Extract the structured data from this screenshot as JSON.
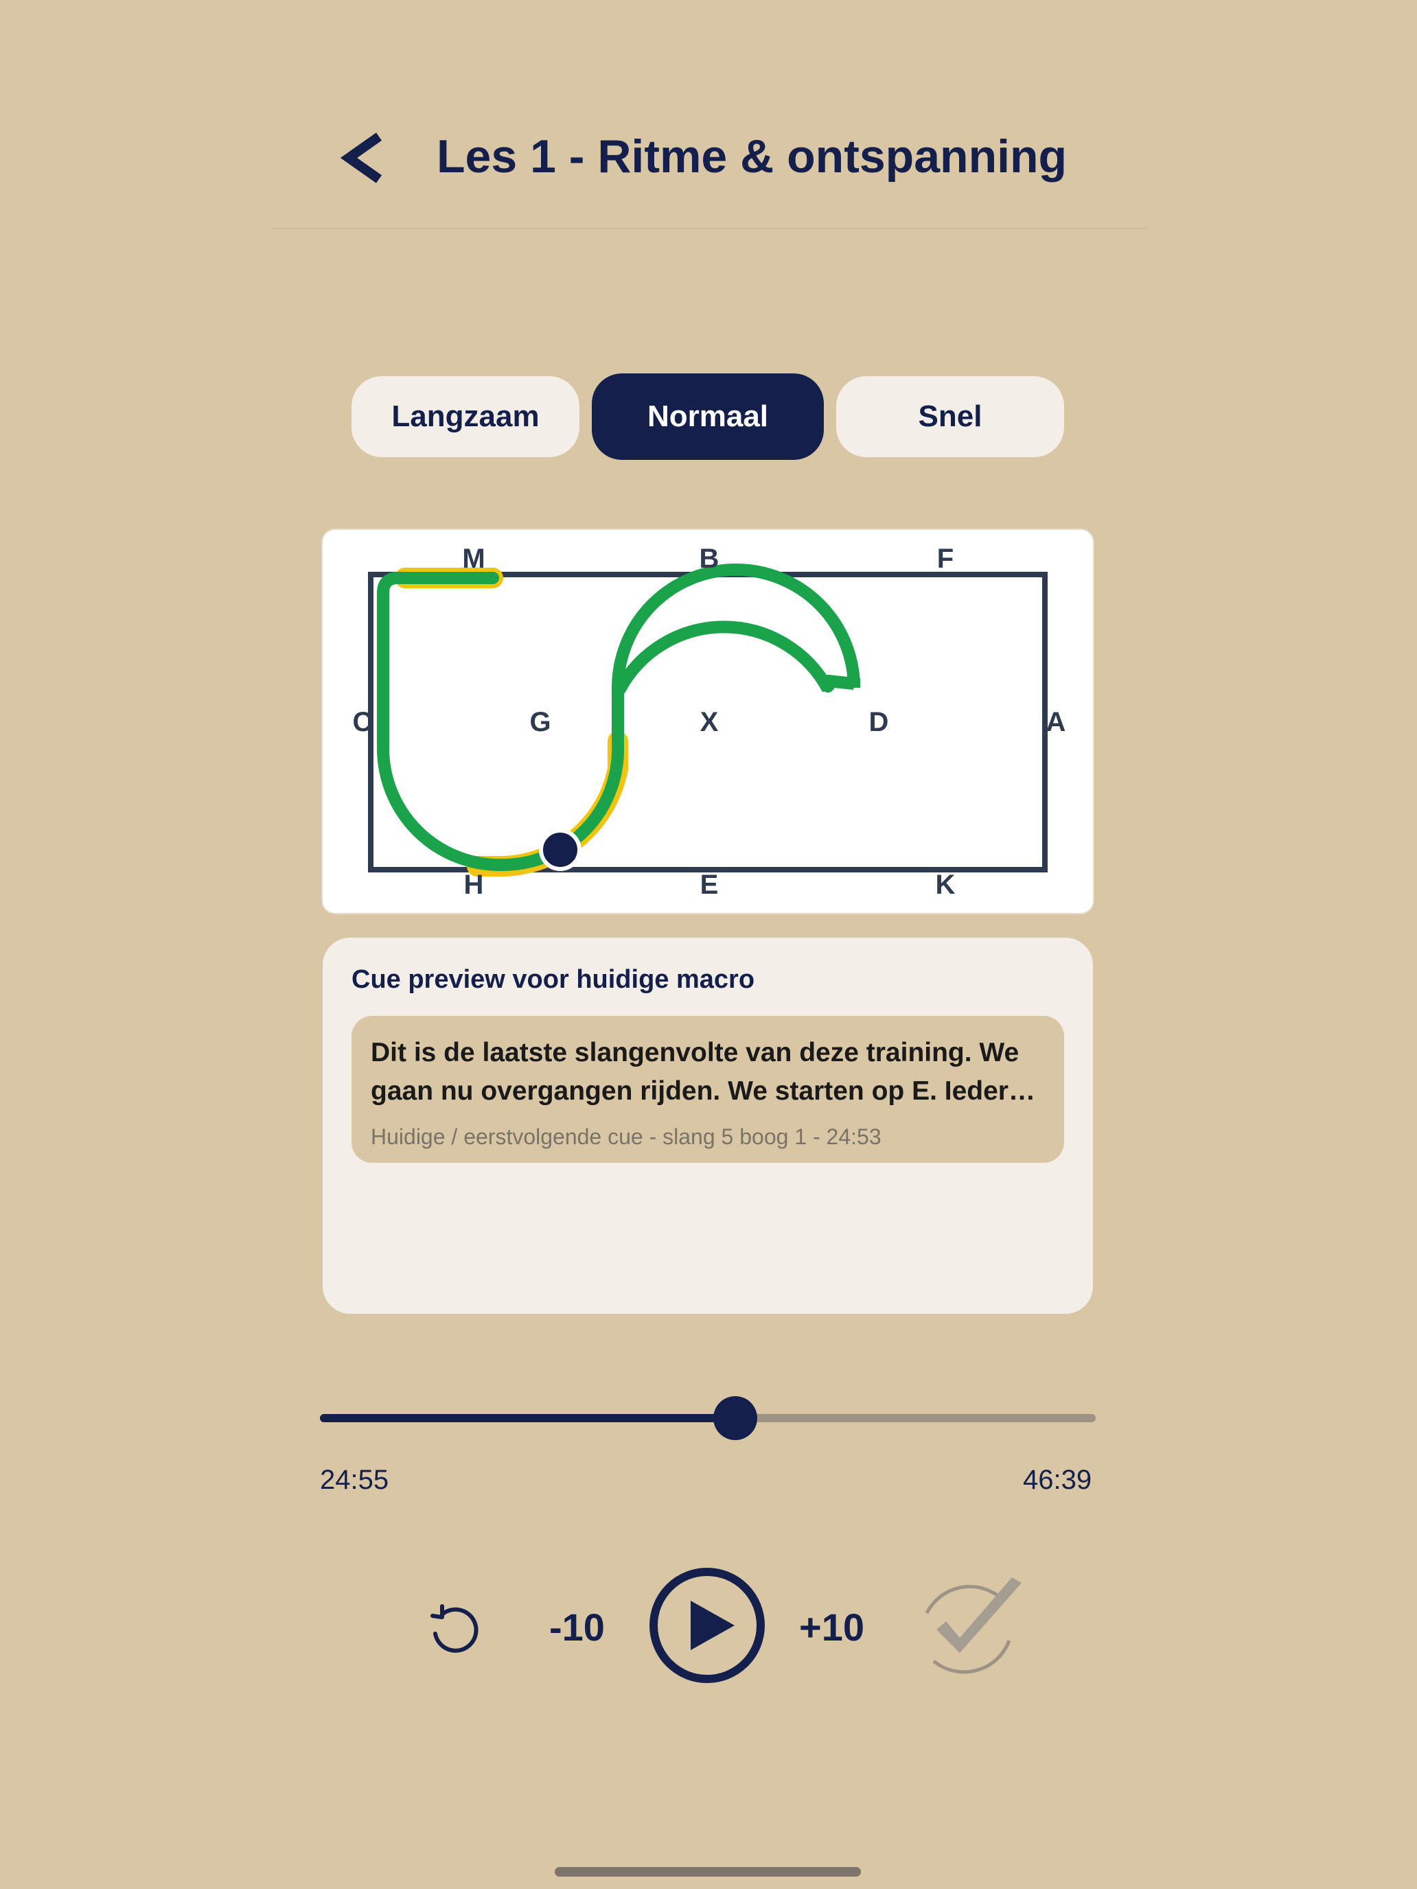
{
  "header": {
    "title": "Les 1 - Ritme & ontspanning",
    "back_icon": "chevron-left-icon"
  },
  "speed": {
    "options": [
      "Langzaam",
      "Normaal",
      "Snel"
    ],
    "selected": "Normaal"
  },
  "arena": {
    "letters": {
      "top": [
        "M",
        "B",
        "F"
      ],
      "middle": [
        "C",
        "G",
        "X",
        "D",
        "A"
      ],
      "bottom": [
        "H",
        "E",
        "K"
      ]
    },
    "colors": {
      "route": "#1aa34a",
      "highlight": "#f1c40f",
      "rider": "#14204b",
      "border": "#2e3a4f"
    }
  },
  "cue": {
    "title": "Cue preview voor huidige macro",
    "text": "Dit is de laatste slangenvolte van deze training. We gaan nu overgangen rijden. We starten op E. Ieder…",
    "meta": "Huidige / eerstvolgende cue - slang 5 boog 1 - 24:53"
  },
  "player": {
    "elapsed": "24:55",
    "total": "46:39",
    "progress_fraction": 0.535,
    "restart_icon": "restart-icon",
    "back_label": "-10",
    "forward_label": "+10",
    "play_icon": "play-icon",
    "complete_icon": "checkmark-icon"
  },
  "colors": {
    "background": "#d8c6a5",
    "primary": "#14204b",
    "card": "#f3efe8"
  }
}
